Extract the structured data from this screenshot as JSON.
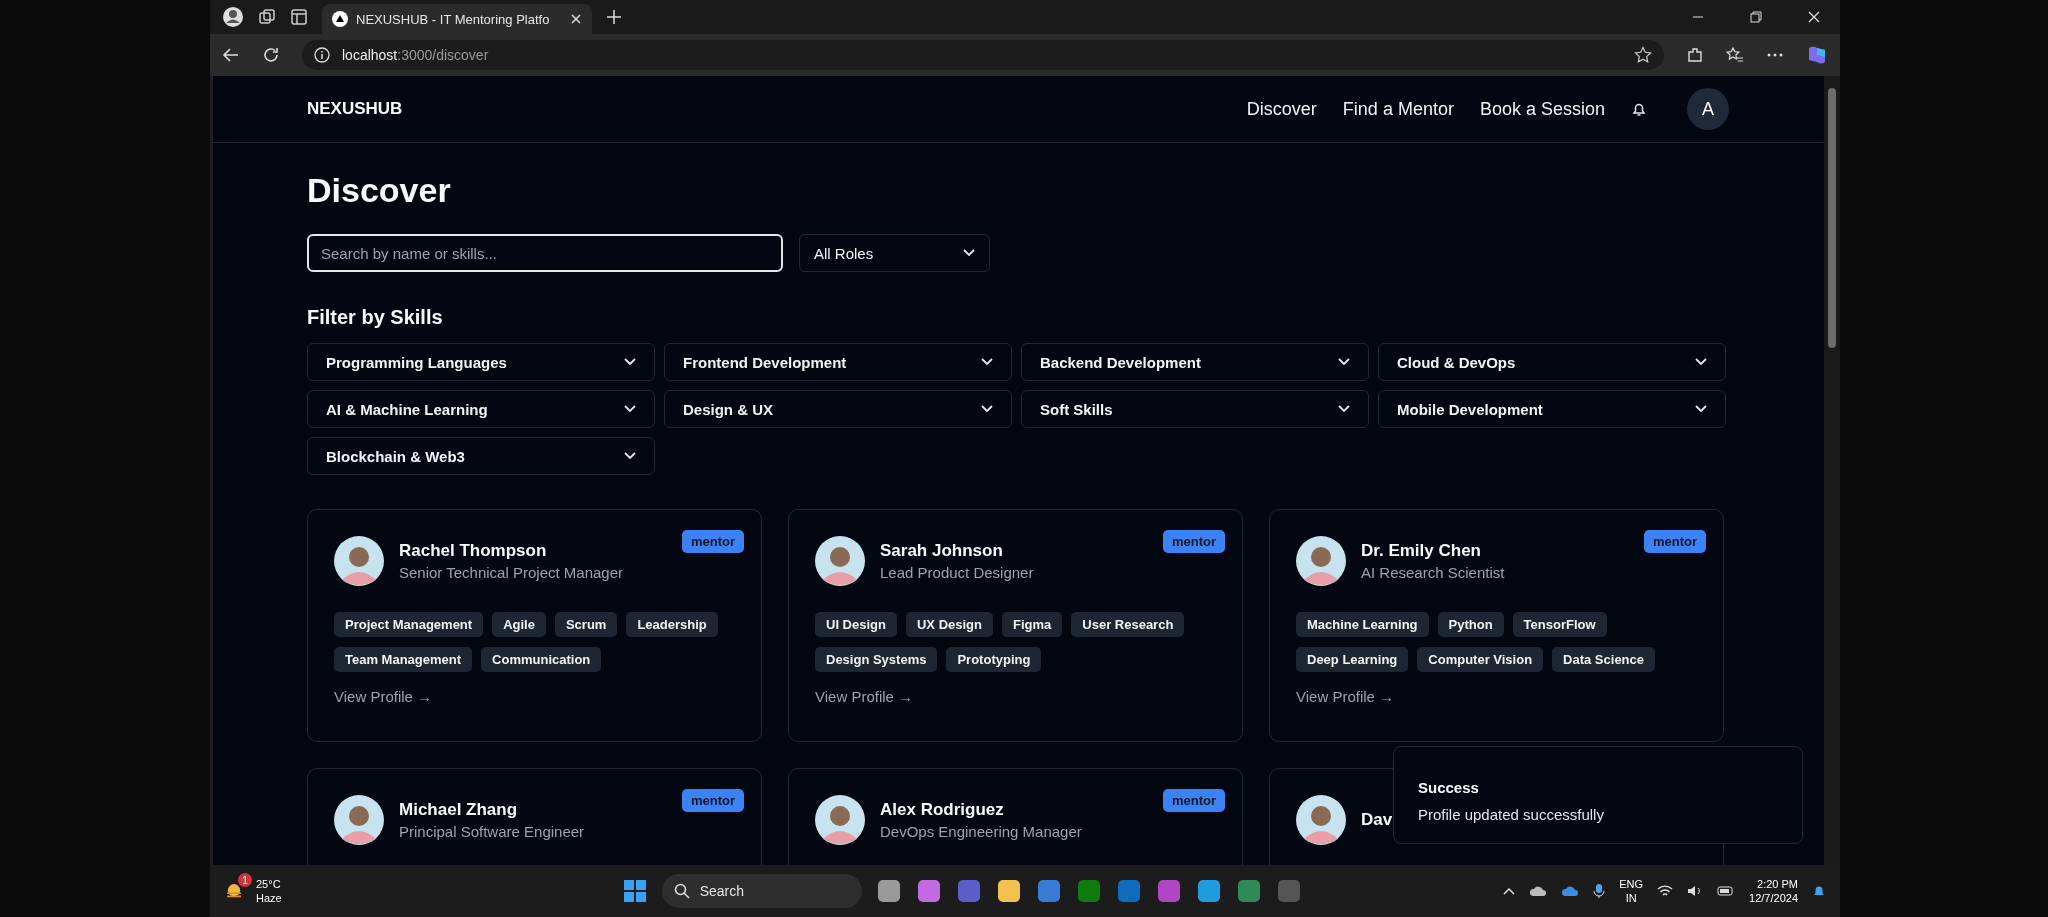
{
  "browser": {
    "tab_title": "NEXUSHUB - IT Mentoring Platfo",
    "url_host": "localhost",
    "url_path": ":3000/discover"
  },
  "header": {
    "brand": "NEXUSHUB",
    "nav": [
      {
        "label": "Discover"
      },
      {
        "label": "Find a Mentor"
      },
      {
        "label": "Book a Session"
      }
    ],
    "avatar_initial": "A"
  },
  "page": {
    "title": "Discover",
    "search": {
      "placeholder": "Search by name or skills...",
      "focused": true
    },
    "role_select": "All Roles",
    "filter_title": "Filter by Skills",
    "skill_groups": [
      "Programming Languages",
      "Frontend Development",
      "Backend Development",
      "Cloud & DevOps",
      "AI & Machine Learning",
      "Design & UX",
      "Soft Skills",
      "Mobile Development",
      "Blockchain & Web3"
    ]
  },
  "cards": [
    {
      "name": "Rachel Thompson",
      "title": "Senior Technical Project Manager",
      "badge": "mentor",
      "tags": [
        "Project Management",
        "Agile",
        "Scrum",
        "Leadership",
        "Team Management",
        "Communication"
      ],
      "link": "View Profile →"
    },
    {
      "name": "Sarah Johnson",
      "title": "Lead Product Designer",
      "badge": "mentor",
      "tags": [
        "UI Design",
        "UX Design",
        "Figma",
        "User Research",
        "Design Systems",
        "Prototyping"
      ],
      "link": "View Profile →"
    },
    {
      "name": "Dr. Emily Chen",
      "title": "AI Research Scientist",
      "badge": "mentor",
      "tags": [
        "Machine Learning",
        "Python",
        "TensorFlow",
        "Deep Learning",
        "Computer Vision",
        "Data Science"
      ],
      "link": "View Profile →"
    },
    {
      "name": "Michael Zhang",
      "title": "Principal Software Engineer",
      "badge": "mentor"
    },
    {
      "name": "Alex Rodriguez",
      "title": "DevOps Engineering Manager",
      "badge": "mentor"
    },
    {
      "name": "Dav"
    }
  ],
  "toast": {
    "title": "Success",
    "message": "Profile updated successfully"
  },
  "taskbar": {
    "temperature": "25°C",
    "weather": "Haze",
    "weather_badge": "1",
    "search": "Search",
    "language": "ENG",
    "region": "IN",
    "time": "2:20 PM",
    "date": "12/7/2024"
  }
}
